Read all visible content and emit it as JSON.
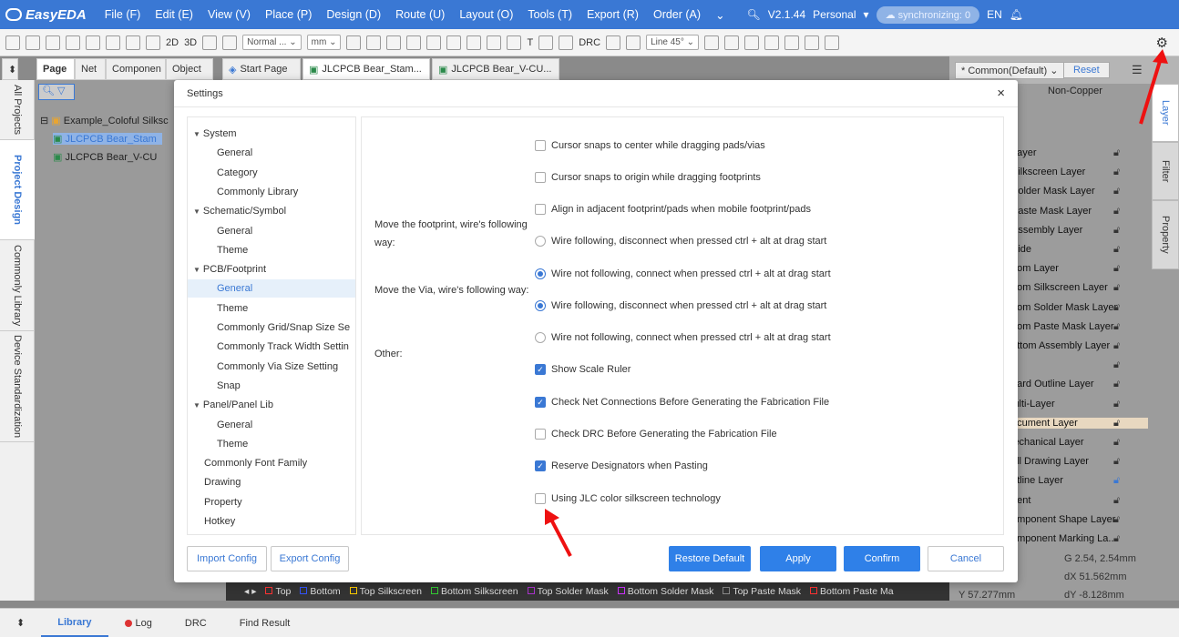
{
  "app": {
    "logo": "EasyEDA",
    "menu": [
      "File (F)",
      "Edit (E)",
      "View (V)",
      "Place (P)",
      "Design (D)",
      "Route (U)",
      "Layout (O)",
      "Tools (T)",
      "Export (R)",
      "Order (A)"
    ],
    "version": "V2.1.44",
    "plan": "Personal",
    "sync_status": "synchronizing: 0",
    "language": "EN"
  },
  "toolbar": {
    "view_2d": "2D",
    "view_3d": "3D",
    "mode_select": "Normal ...",
    "unit_select": "mm",
    "drc": "DRC",
    "line_angle": "Line 45°"
  },
  "left_panel": {
    "tabs": [
      "Page",
      "Net",
      "Componen",
      "Object"
    ],
    "vertical_tabs": [
      "All Projects",
      "Project Design",
      "Commonly Library",
      "Device Standardization"
    ],
    "tree": {
      "project": "Example_Coloful Silksc",
      "items": [
        "JLCPCB Bear_Stam",
        "JLCPCB Bear_V-CU"
      ]
    }
  },
  "doc_tabs": [
    "Start Page",
    "JLCPCB Bear_Stam...",
    "JLCPCB Bear_V-CU..."
  ],
  "settings": {
    "title": "Settings",
    "nav": [
      {
        "label": "System",
        "level": 0
      },
      {
        "label": "General",
        "level": 1
      },
      {
        "label": "Category",
        "level": 1
      },
      {
        "label": "Commonly Library",
        "level": 1
      },
      {
        "label": "Schematic/Symbol",
        "level": 0
      },
      {
        "label": "General",
        "level": 1
      },
      {
        "label": "Theme",
        "level": 1
      },
      {
        "label": "PCB/Footprint",
        "level": 0
      },
      {
        "label": "General",
        "level": 1,
        "active": true
      },
      {
        "label": "Theme",
        "level": 1
      },
      {
        "label": "Commonly Grid/Snap Size Se",
        "level": 1
      },
      {
        "label": "Commonly Track Width Settin",
        "level": 1
      },
      {
        "label": "Commonly Via Size Setting",
        "level": 1
      },
      {
        "label": "Snap",
        "level": 1
      },
      {
        "label": "Panel/Panel Lib",
        "level": 0
      },
      {
        "label": "General",
        "level": 1
      },
      {
        "label": "Theme",
        "level": 1
      },
      {
        "label": "Commonly Font Family",
        "level": 2
      },
      {
        "label": "Drawing",
        "level": 2
      },
      {
        "label": "Property",
        "level": 2
      },
      {
        "label": "Hotkey",
        "level": 2
      }
    ],
    "labels": {
      "footprint_wire": "Move the footprint, wire's following way:",
      "via_wire": "Move the Via, wire's following way:",
      "other": "Other:"
    },
    "options": [
      {
        "type": "checkbox",
        "checked": false,
        "label": "Cursor snaps to center while dragging pads/vias"
      },
      {
        "type": "checkbox",
        "checked": false,
        "label": "Cursor snaps to origin while dragging footprints"
      },
      {
        "type": "checkbox",
        "checked": false,
        "label": "Align in adjacent footprint/pads when mobile footprint/pads"
      },
      {
        "type": "radio",
        "checked": false,
        "label": "Wire following, disconnect when pressed ctrl + alt at drag start"
      },
      {
        "type": "radio",
        "checked": true,
        "label": "Wire not following, connect when pressed ctrl + alt at drag start"
      },
      {
        "type": "radio",
        "checked": true,
        "label": "Wire following, disconnect when pressed ctrl + alt at drag start"
      },
      {
        "type": "radio",
        "checked": false,
        "label": "Wire not following, connect when pressed ctrl + alt at drag start"
      },
      {
        "type": "checkbox",
        "checked": true,
        "label": "Show Scale Ruler"
      },
      {
        "type": "checkbox",
        "checked": true,
        "label": "Check Net Connections Before Generating the Fabrication File"
      },
      {
        "type": "checkbox",
        "checked": false,
        "label": "Check DRC Before Generating the Fabrication File"
      },
      {
        "type": "checkbox",
        "checked": true,
        "label": "Reserve Designators when Pasting"
      },
      {
        "type": "checkbox",
        "checked": false,
        "label": "Using JLC color silkscreen technology"
      }
    ],
    "buttons": {
      "import": "Import Config",
      "export": "Export Config",
      "restore": "Restore Default",
      "apply": "Apply",
      "confirm": "Confirm",
      "cancel": "Cancel"
    }
  },
  "right_panel": {
    "preset": "* Common(Default)",
    "reset": "Reset",
    "filter_tab": "Non-Copper",
    "tabs": [
      "Layer",
      "Filter",
      "Property"
    ],
    "layers": [
      "Layer",
      "Silkscreen Layer",
      "Solder Mask Layer",
      "Paste Mask Layer",
      "Assembly Layer",
      "Side",
      "ttom Layer",
      "ttom Silkscreen Layer",
      "ttom Solder Mask Layer",
      "ttom Paste Mask Layer",
      "ottom Assembly Layer",
      "",
      "oard Outline Layer",
      "lulti-Layer",
      "ocument Layer",
      "lechanical Layer",
      "rill Drawing Layer",
      "atline Layer",
      "nent",
      "omponent Shape Layer",
      "omponent Marking La..."
    ],
    "grid": "G  2.54, 2.54mm",
    "dx": "dX  51.562mm",
    "y": "Y  57.277mm",
    "dy": "dY  -8.128mm"
  },
  "layer_strip": [
    {
      "name": "Top",
      "color": "#ff3333"
    },
    {
      "name": "Bottom",
      "color": "#3355ff"
    },
    {
      "name": "Top Silkscreen",
      "color": "#ffcc00"
    },
    {
      "name": "Bottom Silkscreen",
      "color": "#33cc33"
    },
    {
      "name": "Top Solder Mask",
      "color": "#aa33cc"
    },
    {
      "name": "Bottom Solder Mask",
      "color": "#cc33ff"
    },
    {
      "name": "Top Paste Mask",
      "color": "#888888"
    },
    {
      "name": "Bottom Paste Ma",
      "color": "#ff3333"
    }
  ],
  "bottom_tabs": [
    "Library",
    "Log",
    "DRC",
    "Find Result"
  ],
  "colors": {
    "accent": "#3a78d4",
    "primary_button": "#2f80e8",
    "annotation_arrow": "#ee1111"
  }
}
